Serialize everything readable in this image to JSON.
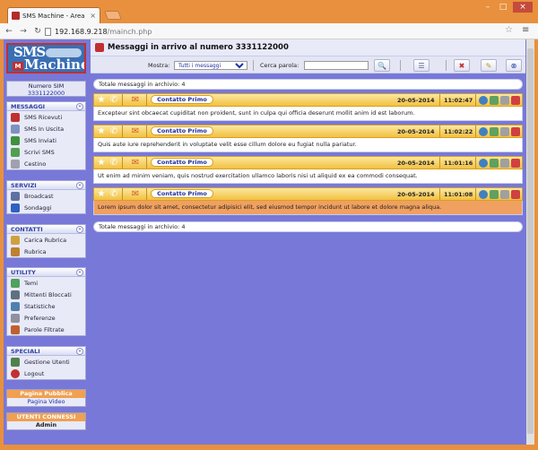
{
  "browser": {
    "tab_title": "SMS Machine - Area SX",
    "url_host": "192.168.9.218",
    "url_path": "/mainch.php"
  },
  "sidebar": {
    "logo_top": "SMS",
    "logo_bottom": "Machine",
    "sim_label": "Numero SIM",
    "sim_number": "3331122000",
    "sections": [
      {
        "title": "MESSAGGI",
        "items": [
          "SMS Ricevuti",
          "SMS In Uscita",
          "SMS Inviati",
          "Scrivi SMS",
          "Cestino"
        ]
      },
      {
        "title": "SERVIZI",
        "items": [
          "Broadcast",
          "Sondaggi"
        ]
      },
      {
        "title": "CONTATTI",
        "items": [
          "Carica Rubrica",
          "Rubrica"
        ]
      },
      {
        "title": "UTILITY",
        "items": [
          "Temi",
          "Mittenti Bloccati",
          "Statistiche",
          "Preferenze",
          "Parole Filtrate"
        ]
      },
      {
        "title": "SPECIALI",
        "items": [
          "Gestione Utenti",
          "Logout"
        ]
      }
    ],
    "public_page_title": "Pagina Pubblica",
    "public_page_link": "Pagina Video",
    "connected_title": "UTENTI CONNESSI",
    "connected_user": "Admin"
  },
  "main": {
    "header_title": "Messaggi in arrivo al numero 3331122000",
    "filter_label": "Mostra:",
    "filter_value": "Tutti i messaggi",
    "search_label": "Cerca parola:",
    "search_value": "",
    "total_top": "Totale messaggi in archivio: 4",
    "total_bottom": "Totale messaggi in archivio: 4",
    "messages": [
      {
        "contact": "Contatto Primo",
        "date": "20-05-2014",
        "time": "11:02:47",
        "text": "Excepteur sint obcaecat cupiditat non proident, sunt in culpa qui officia deserunt mollit anim id est laborum."
      },
      {
        "contact": "Contatto Primo",
        "date": "20-05-2014",
        "time": "11:02:22",
        "text": "Quis aute iure reprehenderit in voluptate velit esse cillum dolore eu fugiat nulla pariatur."
      },
      {
        "contact": "Contatto Primo",
        "date": "20-05-2014",
        "time": "11:01:16",
        "text": "Ut enim ad minim veniam, quis nostrud exercitation ullamco laboris nisi ut aliquid ex ea commodi consequat."
      },
      {
        "contact": "Contatto Primo",
        "date": "20-05-2014",
        "time": "11:01:08",
        "text": "Lorem ipsum dolor sit amet, consectetur adipisici elit, sed eiusmod tempor incidunt ut labore et dolore magna aliqua."
      }
    ]
  },
  "colors": {
    "page_bg": "#7878d8",
    "message_bar": "#f2c040",
    "highlight_row": "#f0a060",
    "accent": "#3040a0"
  }
}
